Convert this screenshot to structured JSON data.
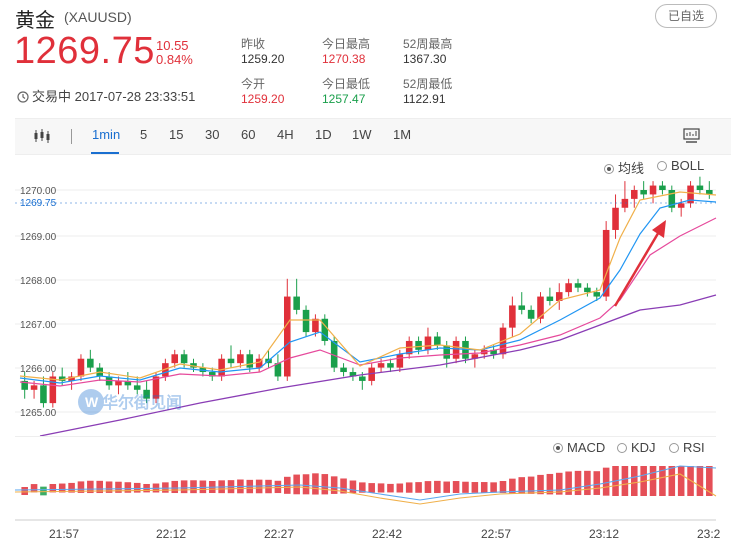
{
  "header": {
    "title": "黄金",
    "symbol": "(XAUUSD)",
    "watch_button": "已自选",
    "price": "1269.75",
    "change": "10.55",
    "change_pct": "0.84%",
    "status": "交易中 2017-07-28 23:33:51",
    "stats": [
      {
        "label": "昨收",
        "value": "1259.20",
        "color": "normal"
      },
      {
        "label": "今日最高",
        "value": "1270.38",
        "color": "red"
      },
      {
        "label": "52周最高",
        "value": "1367.30",
        "color": "normal"
      },
      {
        "label": "今开",
        "value": "1259.20",
        "color": "red"
      },
      {
        "label": "今日最低",
        "value": "1257.47",
        "color": "green"
      },
      {
        "label": "52周最低",
        "value": "1122.91",
        "color": "normal"
      }
    ]
  },
  "toolbar": {
    "chart_icon": "candlestick-icon",
    "intervals": [
      "1min",
      "5",
      "15",
      "30",
      "60",
      "4H",
      "1D",
      "1W",
      "1M"
    ],
    "active_interval": "1min",
    "screen_icon": "monitor-icon"
  },
  "main_chart": {
    "overlay_options": [
      {
        "label": "均线",
        "selected": true
      },
      {
        "label": "BOLL",
        "selected": false
      }
    ],
    "y_ticks": [
      "1270.00",
      "1269.00",
      "1268.00",
      "1267.00",
      "1266.00",
      "1265.00"
    ],
    "current_price_label": "1269.75",
    "watermark": "华尔街见闻"
  },
  "sub_chart": {
    "indicator_options": [
      {
        "label": "MACD",
        "selected": true
      },
      {
        "label": "KDJ",
        "selected": false
      },
      {
        "label": "RSI",
        "selected": false
      }
    ]
  },
  "time_axis": [
    "21:57",
    "22:12",
    "22:27",
    "22:42",
    "22:57",
    "23:12",
    "23:2"
  ],
  "colors": {
    "up": "#e0303a",
    "down": "#1a9f4b",
    "accent": "#1a6fd0",
    "arrow": "#e0303a"
  },
  "chart_data": {
    "type": "candlestick",
    "ylim": [
      1264.6,
      1270.4
    ],
    "ohlc": [
      [
        1265.7,
        1265.9,
        1265.3,
        1265.5
      ],
      [
        1265.5,
        1265.7,
        1265.3,
        1265.6
      ],
      [
        1265.6,
        1265.8,
        1265.1,
        1265.2
      ],
      [
        1265.2,
        1265.9,
        1265.1,
        1265.8
      ],
      [
        1265.8,
        1266.0,
        1265.6,
        1265.7
      ],
      [
        1265.7,
        1265.9,
        1265.5,
        1265.8
      ],
      [
        1265.8,
        1266.3,
        1265.7,
        1266.2
      ],
      [
        1266.2,
        1266.4,
        1265.9,
        1266.0
      ],
      [
        1266.0,
        1266.1,
        1265.7,
        1265.8
      ],
      [
        1265.8,
        1265.9,
        1265.5,
        1265.6
      ],
      [
        1265.6,
        1265.8,
        1265.4,
        1265.7
      ],
      [
        1265.7,
        1265.9,
        1265.5,
        1265.6
      ],
      [
        1265.6,
        1265.8,
        1265.4,
        1265.5
      ],
      [
        1265.5,
        1265.7,
        1265.2,
        1265.3
      ],
      [
        1265.3,
        1265.9,
        1265.2,
        1265.8
      ],
      [
        1265.8,
        1266.2,
        1265.7,
        1266.1
      ],
      [
        1266.1,
        1266.4,
        1266.0,
        1266.3
      ],
      [
        1266.3,
        1266.4,
        1266.0,
        1266.1
      ],
      [
        1266.1,
        1266.2,
        1265.9,
        1266.0
      ],
      [
        1266.0,
        1266.1,
        1265.8,
        1265.9
      ],
      [
        1265.9,
        1266.0,
        1265.7,
        1265.8
      ],
      [
        1265.8,
        1266.3,
        1265.7,
        1266.2
      ],
      [
        1266.2,
        1266.5,
        1266.0,
        1266.1
      ],
      [
        1266.1,
        1266.4,
        1266.0,
        1266.3
      ],
      [
        1266.3,
        1266.4,
        1265.9,
        1266.0
      ],
      [
        1266.0,
        1266.3,
        1265.9,
        1266.2
      ],
      [
        1266.2,
        1266.4,
        1266.0,
        1266.1
      ],
      [
        1266.1,
        1266.3,
        1265.7,
        1265.8
      ],
      [
        1265.8,
        1268.0,
        1265.7,
        1267.6
      ],
      [
        1267.6,
        1268.0,
        1267.2,
        1267.3
      ],
      [
        1267.3,
        1267.4,
        1266.7,
        1266.8
      ],
      [
        1266.8,
        1267.2,
        1266.7,
        1267.1
      ],
      [
        1267.1,
        1267.2,
        1266.5,
        1266.6
      ],
      [
        1266.6,
        1266.7,
        1265.9,
        1266.0
      ],
      [
        1266.0,
        1266.1,
        1265.8,
        1265.9
      ],
      [
        1265.9,
        1266.0,
        1265.7,
        1265.8
      ],
      [
        1265.8,
        1265.9,
        1265.5,
        1265.7
      ],
      [
        1265.7,
        1266.1,
        1265.6,
        1266.0
      ],
      [
        1266.0,
        1266.2,
        1265.9,
        1266.1
      ],
      [
        1266.1,
        1266.2,
        1265.9,
        1266.0
      ],
      [
        1266.0,
        1266.4,
        1265.9,
        1266.3
      ],
      [
        1266.3,
        1266.7,
        1266.2,
        1266.6
      ],
      [
        1266.6,
        1266.7,
        1266.3,
        1266.4
      ],
      [
        1266.4,
        1266.9,
        1266.3,
        1266.7
      ],
      [
        1266.7,
        1266.8,
        1266.4,
        1266.5
      ],
      [
        1266.5,
        1266.6,
        1266.0,
        1266.2
      ],
      [
        1266.2,
        1266.7,
        1266.1,
        1266.6
      ],
      [
        1266.6,
        1266.7,
        1266.1,
        1266.2
      ],
      [
        1266.2,
        1266.4,
        1266.0,
        1266.3
      ],
      [
        1266.3,
        1266.5,
        1266.2,
        1266.4
      ],
      [
        1266.4,
        1266.5,
        1266.2,
        1266.3
      ],
      [
        1266.3,
        1267.0,
        1266.2,
        1266.9
      ],
      [
        1266.9,
        1267.6,
        1266.7,
        1267.4
      ],
      [
        1267.4,
        1267.7,
        1267.2,
        1267.3
      ],
      [
        1267.3,
        1267.4,
        1267.0,
        1267.1
      ],
      [
        1267.1,
        1267.7,
        1267.0,
        1267.6
      ],
      [
        1267.6,
        1267.8,
        1267.4,
        1267.5
      ],
      [
        1267.5,
        1267.9,
        1267.3,
        1267.7
      ],
      [
        1267.7,
        1268.0,
        1267.6,
        1267.9
      ],
      [
        1267.9,
        1268.0,
        1267.7,
        1267.8
      ],
      [
        1267.8,
        1267.9,
        1267.6,
        1267.7
      ],
      [
        1267.7,
        1267.8,
        1267.5,
        1267.6
      ],
      [
        1267.6,
        1269.3,
        1267.5,
        1269.1
      ],
      [
        1269.1,
        1269.9,
        1268.9,
        1269.6
      ],
      [
        1269.6,
        1270.2,
        1269.5,
        1269.8
      ],
      [
        1269.8,
        1270.1,
        1269.6,
        1270.0
      ],
      [
        1270.0,
        1270.2,
        1269.8,
        1269.9
      ],
      [
        1269.9,
        1270.2,
        1269.7,
        1270.1
      ],
      [
        1270.1,
        1270.2,
        1269.9,
        1270.0
      ],
      [
        1270.0,
        1270.1,
        1269.5,
        1269.6
      ],
      [
        1269.6,
        1269.8,
        1269.4,
        1269.7
      ],
      [
        1269.7,
        1270.2,
        1269.6,
        1270.1
      ],
      [
        1270.1,
        1270.3,
        1269.9,
        1270.0
      ],
      [
        1270.0,
        1270.2,
        1269.8,
        1269.9
      ]
    ]
  }
}
